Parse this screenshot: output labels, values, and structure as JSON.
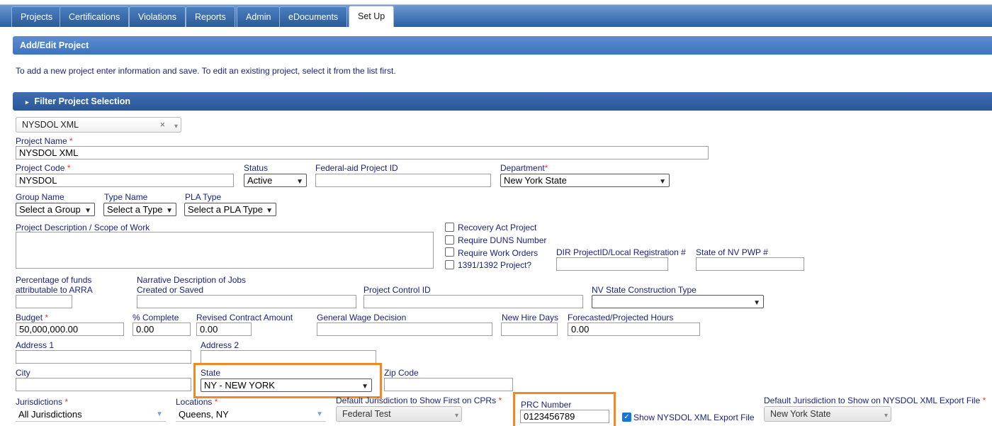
{
  "tabs": [
    "Projects",
    "Certifications",
    "Violations",
    "Reports",
    "Admin",
    "eDocuments",
    "Set Up"
  ],
  "active_tab": "Set Up",
  "panel_title": "Add/Edit Project",
  "instructions": "To add a new project enter information and save. To edit an existing project, select it from the list first.",
  "filter_header": "Filter Project Selection",
  "project_picker": {
    "value": "NYSDOL XML",
    "clear_icon": "×",
    "caret": "▾"
  },
  "fields": {
    "project_name": {
      "label": "Project Name",
      "value": "NYSDOL XML"
    },
    "project_code": {
      "label": "Project Code",
      "value": "NYSDOL"
    },
    "status": {
      "label": "Status",
      "value": "Active"
    },
    "federal_aid_id": {
      "label": "Federal-aid Project ID",
      "value": ""
    },
    "department": {
      "label": "Department",
      "value": "New York State"
    },
    "group_name": {
      "label": "Group Name",
      "value": "Select a Group"
    },
    "type_name": {
      "label": "Type Name",
      "value": "Select a Type"
    },
    "pla_type": {
      "label": "PLA Type",
      "value": "Select a PLA Type"
    },
    "description": {
      "label": "Project Description / Scope of Work",
      "value": ""
    },
    "dir_project_id": {
      "label": "DIR ProjectID/Local Registration #",
      "value": ""
    },
    "nv_pwp": {
      "label": "State of NV PWP #",
      "value": ""
    },
    "pct_arra": {
      "label_line1": "Percentage of funds",
      "label_line2": "attributable to ARRA",
      "value": ""
    },
    "narrative": {
      "label_line1": "Narrative Description of Jobs",
      "label_line2": "Created or Saved",
      "value": ""
    },
    "project_control_id": {
      "label": "Project Control ID",
      "value": ""
    },
    "nv_construction_type": {
      "label": "NV State Construction Type",
      "value": ""
    },
    "budget": {
      "label": "Budget",
      "value": "50,000,000.00"
    },
    "pct_complete": {
      "label": "% Complete",
      "value": "0.00"
    },
    "revised_contract": {
      "label": "Revised Contract Amount",
      "value": "0.00"
    },
    "general_wage": {
      "label": "General Wage Decision",
      "value": ""
    },
    "new_hire_days": {
      "label": "New Hire Days",
      "value": ""
    },
    "forecast_hours": {
      "label": "Forecasted/Projected Hours",
      "value": "0.00"
    },
    "address1": {
      "label": "Address 1",
      "value": ""
    },
    "address2": {
      "label": "Address 2",
      "value": ""
    },
    "city": {
      "label": "City",
      "value": ""
    },
    "state": {
      "label": "State",
      "value": "NY - NEW YORK"
    },
    "zip": {
      "label": "Zip Code",
      "value": ""
    },
    "jurisdictions": {
      "label": "Jurisdictions",
      "value": "All Jurisdictions"
    },
    "locations": {
      "label": "Locations",
      "value": "Queens, NY"
    },
    "default_jurisdiction_cpr": {
      "label": "Default Jurisdiction to Show First on CPRs",
      "value": "Federal Test"
    },
    "prc_number": {
      "label": "PRC Number",
      "value": "0123456789"
    },
    "default_jurisdiction_xml": {
      "label": "Default Jurisdiction to Show on NYSDOL XML Export File",
      "value": "New York State"
    }
  },
  "checkboxes": {
    "recovery_act": {
      "label": "Recovery Act Project",
      "checked": false
    },
    "require_duns": {
      "label": "Require DUNS Number",
      "checked": false
    },
    "require_work_orders": {
      "label": "Require Work Orders",
      "checked": false
    },
    "project_1391": {
      "label": "1391/1392 Project?",
      "checked": false
    },
    "show_xml_export": {
      "label": "Show NYSDOL XML Export File",
      "checked": true
    }
  },
  "required_marker": "*",
  "highlight_color": "#f08a24"
}
